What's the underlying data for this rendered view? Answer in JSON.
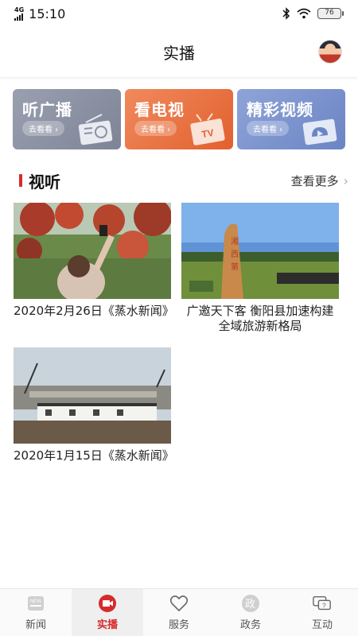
{
  "status_bar": {
    "network": "4G",
    "time": "15:10",
    "battery": "76"
  },
  "header": {
    "title": "实播"
  },
  "categories": [
    {
      "name": "听广播",
      "action": "去看看 ›",
      "icon": "radio-icon"
    },
    {
      "name": "看电视",
      "action": "去看看 ›",
      "icon": "tv-icon"
    },
    {
      "name": "精彩视频",
      "action": "去看看 ›",
      "icon": "video-icon"
    }
  ],
  "section": {
    "title": "视听",
    "more": "查看更多"
  },
  "videos": [
    {
      "caption": "2020年2月26日《蒸水新闻》"
    },
    {
      "caption": "广邀天下客 衡阳县加速构建全域旅游新格局"
    },
    {
      "caption": "2020年1月15日《蒸水新闻》"
    }
  ],
  "tabs": [
    {
      "label": "新闻",
      "icon": "news-icon"
    },
    {
      "label": "实播",
      "icon": "live-icon",
      "active": true
    },
    {
      "label": "服务",
      "icon": "heart-icon"
    },
    {
      "label": "政务",
      "icon": "government-icon"
    },
    {
      "label": "互动",
      "icon": "chat-icon"
    }
  ],
  "colors": {
    "accent": "#d62b2b",
    "radio_card": "#8a90a2",
    "tv_card": "#e8703f",
    "video_card": "#7a92cf"
  }
}
